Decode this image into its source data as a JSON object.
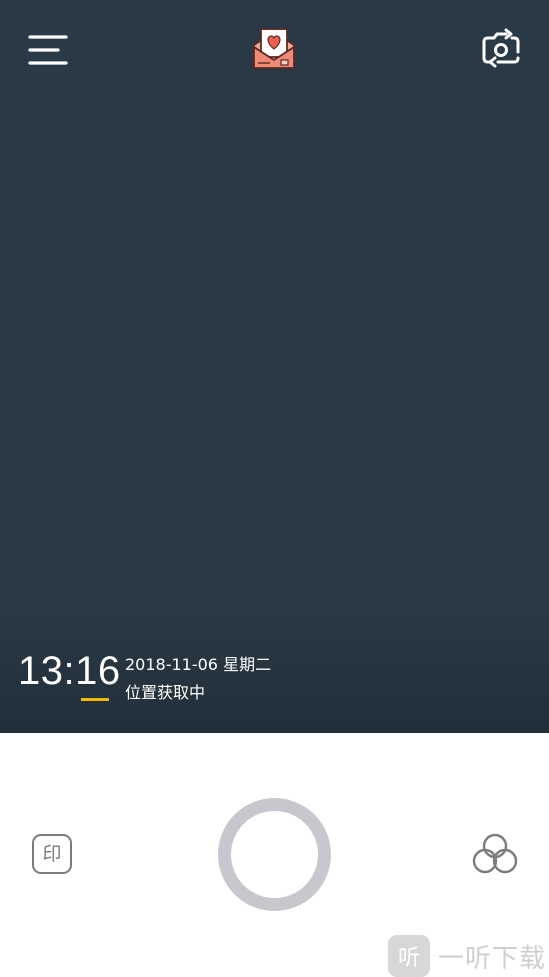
{
  "top_bar": {
    "menu_icon": "hamburger-menu-icon",
    "center_icon": "love-letter-envelope-icon",
    "flip_icon": "camera-flip-icon"
  },
  "watermark": {
    "time": "13:16",
    "date": "2018-11-06 星期二",
    "location": "位置获取中",
    "accent_color": "#f5b900"
  },
  "controls": {
    "stamp_label": "印",
    "shutter_icon": "shutter-ring-icon",
    "filter_icon": "filter-circles-icon"
  },
  "site_mark": {
    "logo_glyph": "听",
    "name": "一听下载"
  },
  "colors": {
    "viewfinder_bg": "#293945",
    "control_bar_bg": "#ffffff",
    "shutter_ring": "#c6c8cd"
  }
}
